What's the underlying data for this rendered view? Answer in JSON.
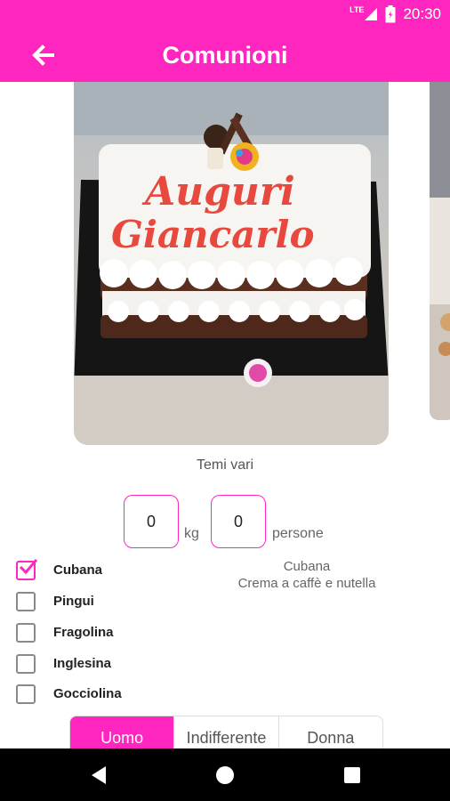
{
  "status_bar": {
    "time": "20:30",
    "network": "LTE",
    "icons": [
      "signal-icon",
      "battery-icon"
    ]
  },
  "app_bar": {
    "title": "Comunioni",
    "back_icon": "arrow-left-icon"
  },
  "photo": {
    "caption": "Temi vari",
    "cake_text_line1": "Auguri",
    "cake_text_line2": "Giancarlo"
  },
  "quantity": {
    "kg_value": "0",
    "kg_unit": "kg",
    "people_value": "0",
    "people_unit": "persone"
  },
  "options": [
    {
      "label": "Cubana",
      "checked": true
    },
    {
      "label": "Pingui",
      "checked": false
    },
    {
      "label": "Fragolina",
      "checked": false
    },
    {
      "label": "Inglesina",
      "checked": false
    },
    {
      "label": "Gocciolina",
      "checked": false
    }
  ],
  "description": {
    "name": "Cubana",
    "detail": "Crema a caffè e nutella"
  },
  "gender_tabs": {
    "items": [
      "Uomo",
      "Indifferente",
      "Donna"
    ],
    "selected": "Uomo"
  },
  "colors": {
    "accent": "#ff26c0",
    "nav_bar": "#000000"
  },
  "nav_bar": {
    "icons": [
      "back-triangle-icon",
      "home-circle-icon",
      "recents-square-icon"
    ]
  }
}
